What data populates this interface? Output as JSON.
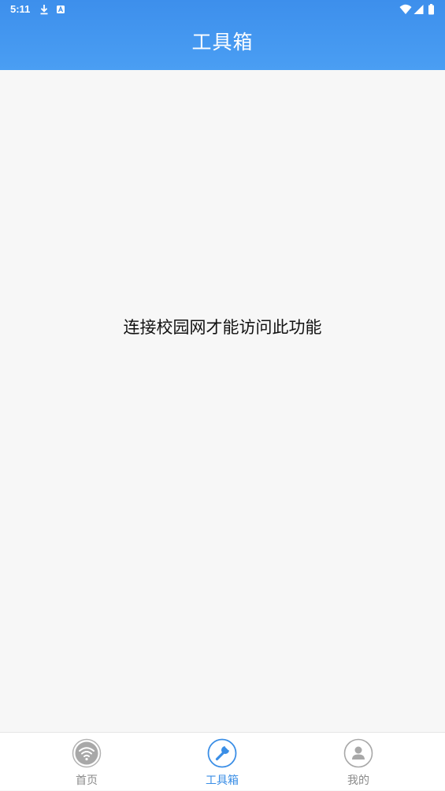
{
  "status_bar": {
    "time": "5:11",
    "left_icons": [
      "download-icon",
      "app-notification-icon"
    ],
    "right_icons": [
      "wifi-icon",
      "signal-icon",
      "battery-icon"
    ]
  },
  "header": {
    "title": "工具箱"
  },
  "main": {
    "message": "连接校园网才能访问此功能"
  },
  "bottom_nav": {
    "items": [
      {
        "label": "首页",
        "icon": "wifi-icon",
        "active": false
      },
      {
        "label": "工具箱",
        "icon": "wrench-icon",
        "active": true
      },
      {
        "label": "我的",
        "icon": "person-icon",
        "active": false
      }
    ]
  },
  "colors": {
    "header_blue": "#3d8fec",
    "active_blue": "#3a8ee6",
    "inactive_gray": "#a8a8a8",
    "background": "#f7f7f7"
  }
}
